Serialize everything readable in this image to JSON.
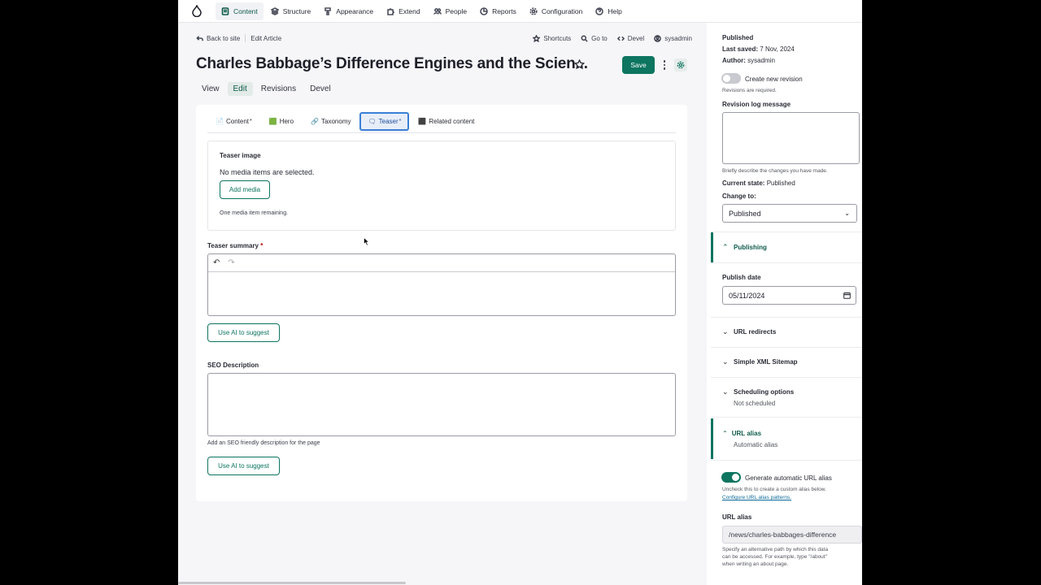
{
  "toolbar": {
    "items": [
      {
        "label": "Content",
        "icon": "content-icon"
      },
      {
        "label": "Structure",
        "icon": "structure-icon"
      },
      {
        "label": "Appearance",
        "icon": "appearance-icon"
      },
      {
        "label": "Extend",
        "icon": "extend-icon"
      },
      {
        "label": "People",
        "icon": "people-icon"
      },
      {
        "label": "Reports",
        "icon": "reports-icon"
      },
      {
        "label": "Configuration",
        "icon": "configuration-icon"
      },
      {
        "label": "Help",
        "icon": "help-icon"
      }
    ]
  },
  "subbar": {
    "back": "Back to site",
    "breadcrumb": "Edit Article",
    "shortcuts": "Shortcuts",
    "goto": "Go to",
    "devel": "Devel",
    "user": "sysadmin"
  },
  "header": {
    "title": "Charles Babbage’s Difference Engines and the Scien...",
    "save": "Save"
  },
  "primary_tabs": [
    "View",
    "Edit",
    "Revisions",
    "Devel"
  ],
  "horizontal_tabs": [
    {
      "emoji": "📄",
      "label": "Content",
      "mark": "*"
    },
    {
      "emoji": "🟩",
      "label": "Hero",
      "mark": ""
    },
    {
      "emoji": "🔗",
      "label": "Taxonomy",
      "mark": ""
    },
    {
      "emoji": "🗨",
      "label": "Teaser",
      "mark": "*"
    },
    {
      "emoji": "⬛",
      "label": "Related content",
      "mark": ""
    }
  ],
  "teaser_image": {
    "label": "Teaser image",
    "empty": "No media items are selected.",
    "add_button": "Add media",
    "remaining": "One media item remaining."
  },
  "teaser_summary": {
    "label": "Teaser summary",
    "required": "*",
    "ai_button": "Use AI to suggest"
  },
  "seo": {
    "label": "SEO Description",
    "help": "Add an SEO friendly description for the page",
    "ai_button": "Use AI to suggest"
  },
  "sidebar": {
    "status": "Published",
    "last_saved_label": "Last saved:",
    "last_saved": "7 Nov, 2024",
    "author_label": "Author:",
    "author": "sysadmin",
    "new_revision": "Create new revision",
    "revisions_required": "Revisions are required.",
    "revision_log_label": "Revision log message",
    "revision_help": "Briefly describe the changes you have made.",
    "current_state_label": "Current state:",
    "current_state": "Published",
    "change_to_label": "Change to:",
    "change_to_value": "Published",
    "publishing": "Publishing",
    "publish_date_label": "Publish date",
    "publish_date": "05/11/2024",
    "url_redirects": "URL redirects",
    "sitemap": "Simple XML Sitemap",
    "scheduling": "Scheduling options",
    "scheduling_sub": "Not scheduled",
    "url_alias_section": "URL alias",
    "url_alias_sub": "Automatic alias",
    "generate_alias": "Generate automatic URL alias",
    "uncheck_help": "Uncheck this to create a custom alias below.",
    "configure_link": "Configure URL alias patterns.",
    "url_alias_label": "URL alias",
    "url_alias_value": "/news/charles-babbages-difference",
    "alias_help_1": "Specify an alternative path by which this data",
    "alias_help_2": "can be accessed. For example, type \"/about\"",
    "alias_help_3": "when writing an about page."
  },
  "colors": {
    "accent": "#0d7560",
    "focus": "#3a7fd5"
  }
}
